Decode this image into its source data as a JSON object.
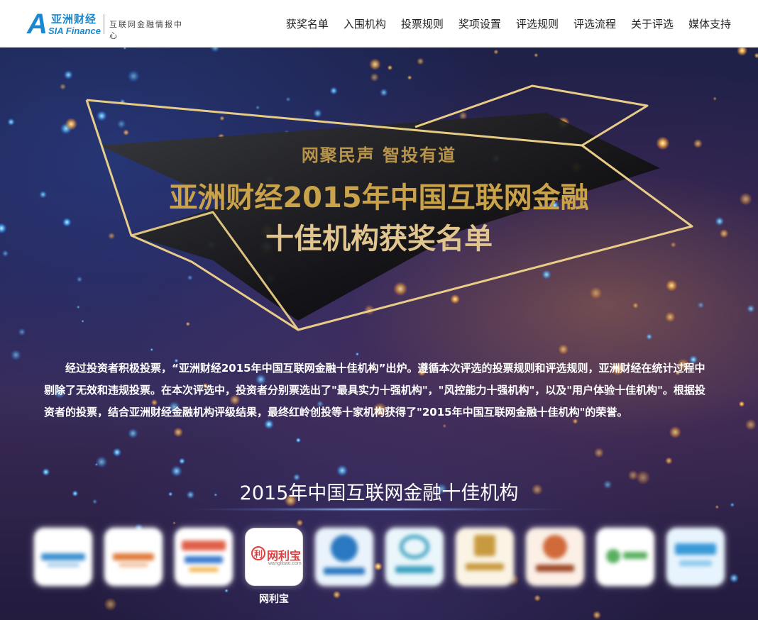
{
  "header": {
    "logo": {
      "mark": "A",
      "name_cn": "亚洲财经",
      "name_en": "SIA Finance",
      "tagline": "互联网金融情报中心"
    },
    "nav": [
      "获奖名单",
      "入围机构",
      "投票规则",
      "奖项设置",
      "评选规则",
      "评选流程",
      "关于评选",
      "媒体支持"
    ]
  },
  "hero": {
    "slogan": "网聚民声  智投有道",
    "title_line1": "亚洲财经2015年中国互联网金融",
    "title_line2": "十佳机构获奖名单",
    "intro": "经过投资者积极投票，“亚洲财经2015年中国互联网金融十佳机构”出炉。遵循本次评选的投票规则和评选规则，亚洲财经在统计过程中剔除了无效和违规投票。在本次评选中，投资者分别票选出了\"最具实力十强机构\"，\"风控能力十强机构\"，以及\"用户体验十佳机构\"。根据投资者的投票，结合亚洲财经金融机构评级结果，最终红岭创投等十家机构获得了\"2015年中国互联网金融十佳机构\"的荣誉。"
  },
  "awards": {
    "section_title": "2015年中国互联网金融十佳机构",
    "tiles": [
      {
        "name": "",
        "icon": "blurred-logo",
        "color": "#3a8fd0"
      },
      {
        "name": "",
        "icon": "blurred-logo",
        "color": "#e07a3a"
      },
      {
        "name": "",
        "icon": "blurred-logo",
        "color": "#e0604a"
      },
      {
        "name": "网利宝",
        "icon": "wanglibao-logo",
        "logo_text": "网利宝",
        "logo_glyph": "利",
        "logo_sub": "wanglibao.com",
        "color": "#e04040"
      },
      {
        "name": "",
        "icon": "blurred-logo",
        "color": "#2a78c0"
      },
      {
        "name": "",
        "icon": "blurred-logo",
        "color": "#3aa0c0"
      },
      {
        "name": "",
        "icon": "blurred-logo",
        "color": "#c89a40"
      },
      {
        "name": "",
        "icon": "blurred-logo",
        "color": "#d06a3a"
      },
      {
        "name": "",
        "icon": "blurred-logo",
        "color": "#5ab060"
      },
      {
        "name": "",
        "icon": "blurred-logo",
        "color": "#3a9ad8"
      }
    ]
  },
  "colors": {
    "brand": "#1a88cf",
    "gold": "#c9a24a",
    "accent_red": "#e04040"
  }
}
